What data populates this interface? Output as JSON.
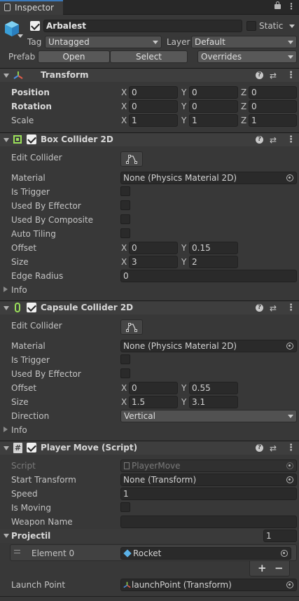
{
  "tab": {
    "label": "Inspector"
  },
  "object": {
    "name": "Arbalest",
    "static_label": "Static",
    "tag_label": "Tag",
    "tag_value": "Untagged",
    "layer_label": "Layer",
    "layer_value": "Default",
    "prefab_label": "Prefab",
    "open_label": "Open",
    "select_label": "Select",
    "overrides_label": "Overrides"
  },
  "transform": {
    "title": "Transform",
    "rows": [
      {
        "label": "Position",
        "x": "0",
        "y": "0",
        "z": "0"
      },
      {
        "label": "Rotation",
        "x": "0",
        "y": "0",
        "z": "0"
      },
      {
        "label": "Scale",
        "x": "1",
        "y": "1",
        "z": "1"
      }
    ]
  },
  "axis": {
    "x": "X",
    "y": "Y",
    "z": "Z"
  },
  "box": {
    "title": "Box Collider 2D",
    "edit_collider": "Edit Collider",
    "material_label": "Material",
    "material_value": "None (Physics Material 2D)",
    "is_trigger": "Is Trigger",
    "used_by_effector": "Used By Effector",
    "used_by_composite": "Used By Composite",
    "auto_tiling": "Auto Tiling",
    "offset_label": "Offset",
    "offset_x": "0",
    "offset_y": "0.15",
    "size_label": "Size",
    "size_x": "3",
    "size_y": "2",
    "edge_radius_label": "Edge Radius",
    "edge_radius_value": "0",
    "info": "Info"
  },
  "capsule": {
    "title": "Capsule Collider 2D",
    "edit_collider": "Edit Collider",
    "material_label": "Material",
    "material_value": "None (Physics Material 2D)",
    "is_trigger": "Is Trigger",
    "used_by_effector": "Used By Effector",
    "offset_label": "Offset",
    "offset_x": "0",
    "offset_y": "0.55",
    "size_label": "Size",
    "size_x": "1.5",
    "size_y": "3.1",
    "direction_label": "Direction",
    "direction_value": "Vertical",
    "info": "Info"
  },
  "script": {
    "title": "Player Move (Script)",
    "script_label": "Script",
    "script_value": "PlayerMove",
    "start_transform_label": "Start Transform",
    "start_transform_value": "None (Transform)",
    "speed_label": "Speed",
    "speed_value": "1",
    "is_moving_label": "Is Moving",
    "weapon_name_label": "Weapon Name",
    "weapon_name_value": "",
    "projectil_label": "Projectil",
    "projectil_count": "1",
    "element_label": "Element 0",
    "element_value": "Rocket",
    "plus": "+",
    "minus": "−",
    "launch_point_label": "Launch Point",
    "launch_point_value": "launchPoint (Transform)"
  },
  "colors": {
    "background": "#383838",
    "header": "#3e3e3e",
    "field": "#2a2a2a",
    "collider_green": "#9be05a"
  }
}
